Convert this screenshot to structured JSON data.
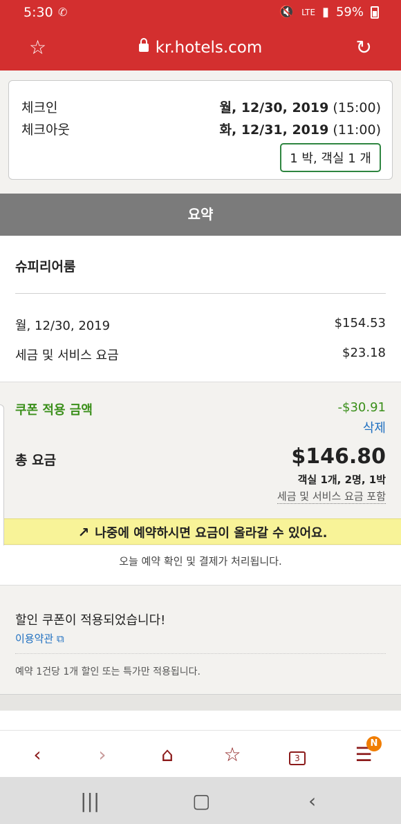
{
  "status_bar": {
    "time": "5:30",
    "battery": "59%",
    "network": "LTE"
  },
  "browser": {
    "url": "kr.hotels.com"
  },
  "booking": {
    "checkin_label": "체크인",
    "checkin_day": "월, 12/30, 2019",
    "checkin_time": "(15:00)",
    "checkout_label": "체크아웃",
    "checkout_day": "화, 12/31, 2019",
    "checkout_time": "(11:00)",
    "nights_rooms": "1 박, 객실 1 개"
  },
  "summary": {
    "header": "요약",
    "room_type": "슈피리어룸",
    "date_label": "월, 12/30, 2019",
    "date_price": "$154.53",
    "tax_label": "세금 및 서비스 요금",
    "tax_price": "$23.18",
    "coupon_label": "쿠폰 적용 금액",
    "coupon_value": "-$30.91",
    "remove_label": "삭제",
    "total_label": "총 요금",
    "total_value": "$146.80",
    "rooms_guests": "객실 1개, 2명, 1박",
    "tax_included": "세금 및 서비스 요금 포함"
  },
  "alert": {
    "text": "나중에 예약하시면 요금이 올라갈 수 있어요."
  },
  "processing_note": "오늘 예약 확인 및 결제가 처리됩니다.",
  "coupon_panel": {
    "applied": "할인 쿠폰이 적용되었습니다!",
    "terms": "이용약관",
    "note": "예약 1건당 1개 할인 또는 특가만 적용됩니다."
  },
  "bottom_nav": {
    "tabs_count": "3",
    "menu_badge": "N"
  },
  "colors": {
    "brand_red": "#d32f2f",
    "green": "#3a8f1a",
    "link_blue": "#1e6fc0",
    "alert_yellow": "#f8f398"
  }
}
